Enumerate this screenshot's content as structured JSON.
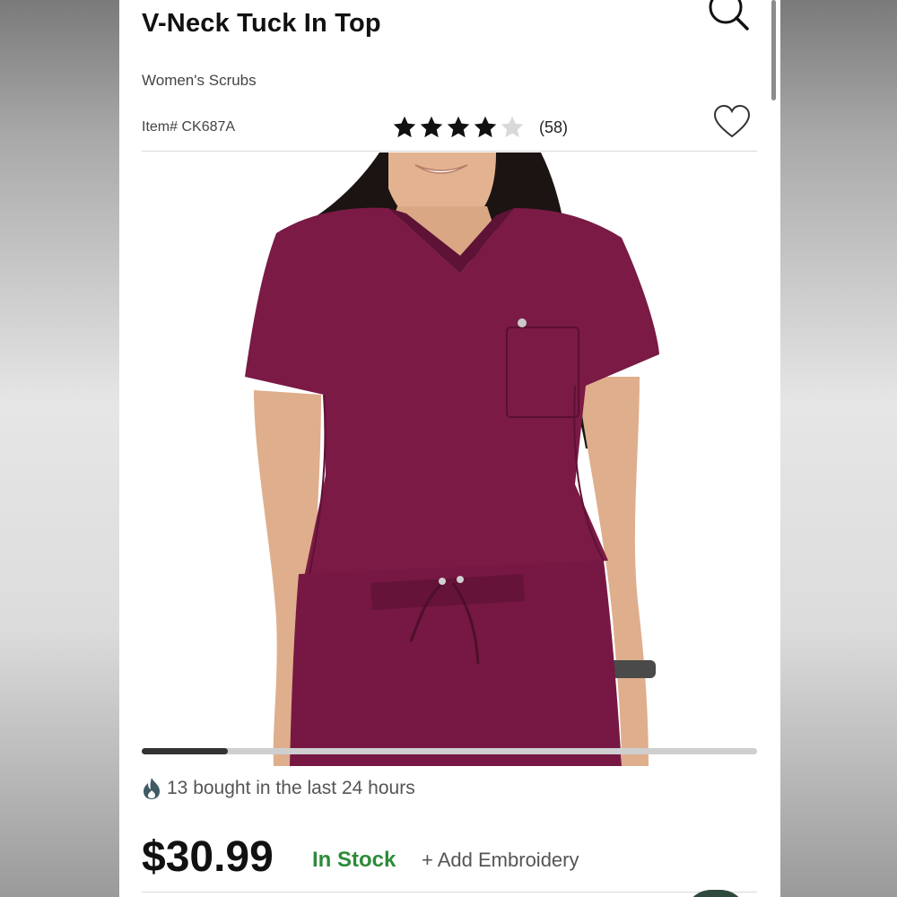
{
  "product": {
    "title": "V-Neck Tuck In Top",
    "category": "Women's Scrubs",
    "item_number": "Item# CK687A",
    "rating": 4,
    "rating_max": 5,
    "review_count": "(58)",
    "social_proof": "13 bought in the last 24 hours",
    "price": "$30.99",
    "stock_status": "In Stock",
    "embroidery_link": "+ Add Embroidery"
  },
  "carousel": {
    "progress": 0.14
  },
  "icons": {
    "search": "search-icon",
    "favorite": "heart-outline-icon",
    "star": "star-icon",
    "trending": "flame-icon"
  },
  "colors": {
    "in_stock": "#2e8b3a",
    "scrub": "#7a1a45",
    "star_filled": "#111111",
    "star_empty": "#d9d9d9"
  }
}
